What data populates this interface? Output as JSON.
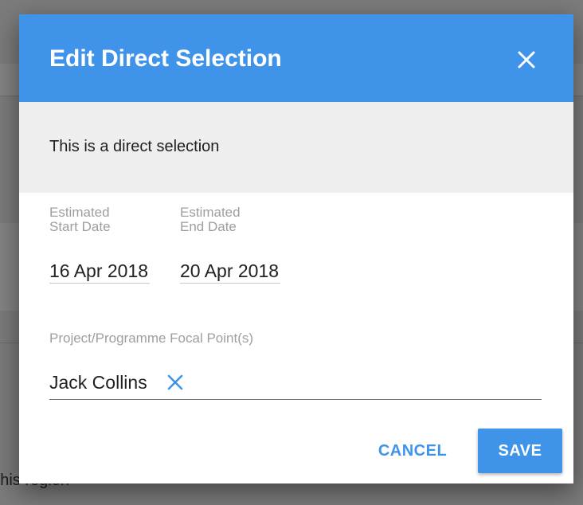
{
  "background": {
    "partial_text": "n this region"
  },
  "dialog": {
    "title": "Edit Direct Selection",
    "close_icon": "close-icon",
    "notice": "This is a direct selection",
    "start_date": {
      "label_line1": "Estimated",
      "label_line2": "Start Date",
      "value": "16 Apr 2018"
    },
    "end_date": {
      "label_line1": "Estimated",
      "label_line2": "End Date",
      "value": "20 Apr 2018"
    },
    "focal_points": {
      "label": "Project/Programme Focal Point(s)",
      "chips": [
        {
          "name": "Jack Collins",
          "remove_icon": "close-icon"
        }
      ]
    },
    "actions": {
      "cancel_label": "CANCEL",
      "save_label": "SAVE"
    }
  },
  "colors": {
    "accent": "#3f93e8",
    "header_text": "#ffffff",
    "notice_background": "#eeeeee",
    "label_text": "#9e9e9e",
    "overlay": "#7b7b7b"
  }
}
